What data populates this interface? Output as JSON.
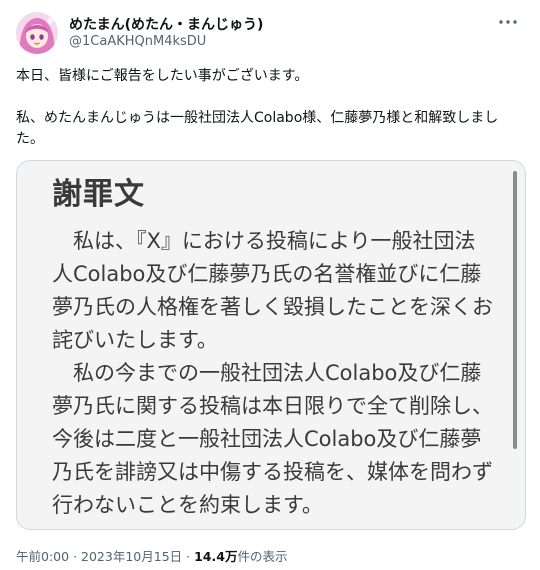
{
  "author": {
    "display_name": "めたまん(めたん・まんじゅう)",
    "handle": "@1CaAKHQnM4ksDU",
    "avatar": "pink-hair-anime-avatar",
    "more_icon": "ellipsis-icon"
  },
  "tweet": {
    "line1": "本日、皆様にご報告をしたい事がございます。",
    "line2": "私、めたんまんじゅうは一般社団法人Colabo様、仁藤夢乃様と和解致しました。"
  },
  "attachment": {
    "title": "謝罪文",
    "paragraph1": "私は、『X』における投稿により一般社団法人Colabo及び仁藤夢乃氏の名誉権並びに仁藤夢乃氏の人格権を著しく毀損したことを深くお詫びいたします。",
    "paragraph2": "私の今までの一般社団法人Colabo及び仁藤夢乃氏に関する投稿は本日限りで全て削除し、今後は二度と一般社団法人Colabo及び仁藤夢乃氏を誹謗又は中傷する投稿を、媒体を問わず行わないことを約束します。"
  },
  "meta": {
    "time": "午前0:00",
    "separator": "·",
    "date": "2023年10月15日",
    "views_count": "14.4万",
    "views_label": "件の表示"
  }
}
